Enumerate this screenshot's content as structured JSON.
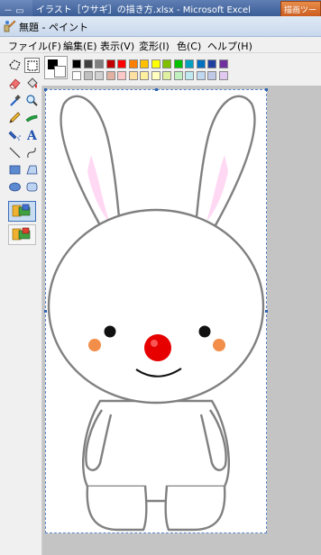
{
  "excel": {
    "left_text": "－ ▭",
    "title": "イラスト［ウサギ］の描き方.xlsx - Microsoft Excel",
    "tool_tab": "描画ツー"
  },
  "paint": {
    "title": "無題 - ペイント"
  },
  "menu": [
    {
      "label": "ファイル(F)"
    },
    {
      "label": "編集(E)"
    },
    {
      "label": "表示(V)"
    },
    {
      "label": "変形(I)"
    },
    {
      "label": "色(C)"
    },
    {
      "label": "ヘルプ(H)"
    }
  ],
  "tools": [
    "free-select-icon",
    "rect-select-icon",
    "eraser-icon",
    "fill-bucket-icon",
    "eyedropper-icon",
    "magnifier-icon",
    "pencil-icon",
    "brush-icon",
    "airbrush-icon",
    "text-icon",
    "line-icon",
    "curve-icon",
    "rectangle-icon",
    "polygon-icon",
    "ellipse-icon",
    "rounded-rect-icon"
  ],
  "colors": {
    "row1": [
      "#000000",
      "#808080",
      "#800000",
      "#808000",
      "#008000",
      "#008080",
      "#000080",
      "#800080",
      "#808040",
      "#004040",
      "#0080ff",
      "#004080",
      "#8000ff",
      "#804000",
      "#c00000",
      "#ff0000",
      "#ff8000",
      "#ffff00",
      "#80ff00",
      "#00ff00",
      "#00a0ff",
      "#4040ff",
      "#6060c0",
      "#8040c0"
    ],
    "palette_row1": [
      "#000000",
      "#404040",
      "#808080",
      "#c00000",
      "#ff0000",
      "#ff8000",
      "#ffc000",
      "#ffff00",
      "#80c000",
      "#00c000",
      "#00a0c0",
      "#0070c0",
      "#2040a0",
      "#7030a0"
    ],
    "palette_row2": [
      "#ffffff",
      "#c0c0c0",
      "#d0d0d0",
      "#e0b0a0",
      "#ffc8c8",
      "#ffe0a0",
      "#fff0a0",
      "#ffffc0",
      "#e0f0a0",
      "#c0f0c0",
      "#c0e8f0",
      "#c0d8f0",
      "#c0c8e8",
      "#e0c8f0"
    ],
    "foreground": "#000000",
    "background": "#ffffff",
    "rabbit_outline": "#808080",
    "ear_inner": "#ffd8f4",
    "nose": "#e60000",
    "cheek": "#f07a2a"
  }
}
